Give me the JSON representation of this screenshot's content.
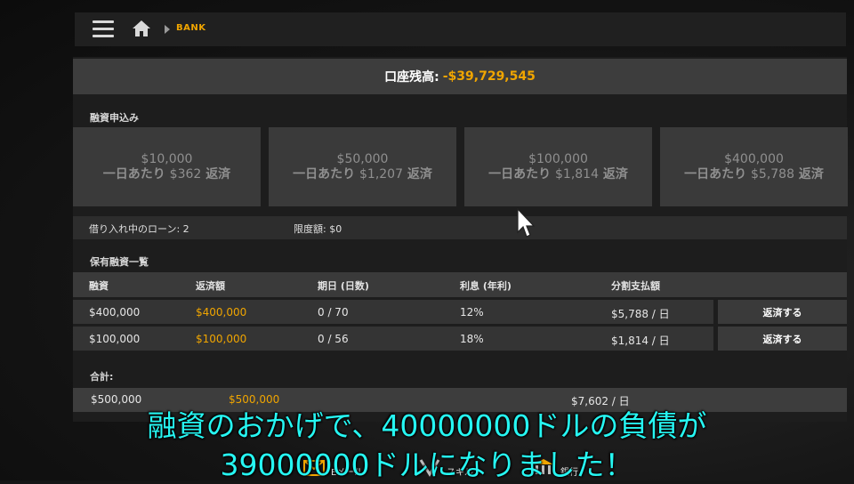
{
  "header": {
    "breadcrumb": "BANK"
  },
  "balance": {
    "label": "口座残高:",
    "value": "-$39,729,545"
  },
  "loan_apply": {
    "title": "融資申込み",
    "cards": [
      {
        "amount": "$10,000",
        "per_day_label": "一日あたり",
        "per_day_amount": "$362",
        "repay_label": "返済"
      },
      {
        "amount": "$50,000",
        "per_day_label": "一日あたり",
        "per_day_amount": "$1,207",
        "repay_label": "返済"
      },
      {
        "amount": "$100,000",
        "per_day_label": "一日あたり",
        "per_day_amount": "$1,814",
        "repay_label": "返済"
      },
      {
        "amount": "$400,000",
        "per_day_label": "一日あたり",
        "per_day_amount": "$5,788",
        "repay_label": "返済"
      }
    ]
  },
  "info": {
    "active_loans": "借り入れ中のローン: 2",
    "limit": "限度額: $0"
  },
  "loans": {
    "title": "保有融資一覧",
    "columns": [
      "融資",
      "返済額",
      "期日 (日数)",
      "利息 (年利)",
      "分割支払額"
    ],
    "rows": [
      {
        "loan": "$400,000",
        "repay": "$400,000",
        "due": "0 / 70",
        "interest": "12%",
        "installment": "$5,788 / 日",
        "action": "返済する"
      },
      {
        "loan": "$100,000",
        "repay": "$100,000",
        "due": "0 / 56",
        "interest": "18%",
        "installment": "$1,814 / 日",
        "action": "返済する"
      }
    ]
  },
  "totals": {
    "title": "合計:",
    "loan": "$500,000",
    "repay": "$500,000",
    "installment": "$7,602 / 日"
  },
  "bottom_nav": [
    {
      "label": "Eメール",
      "icon": "email-icon"
    },
    {
      "label": "スキル",
      "icon": "skill-icon"
    },
    {
      "label": "銀行",
      "icon": "bank-icon"
    }
  ],
  "subtitle": {
    "line1": "融資のおかげで、40000000ドルの負債が",
    "line2": "39000000ドルになりました！"
  },
  "colors": {
    "accent": "#f0a500",
    "subtitle": "#26f6f2",
    "card_bg": "#3a3a3a"
  }
}
